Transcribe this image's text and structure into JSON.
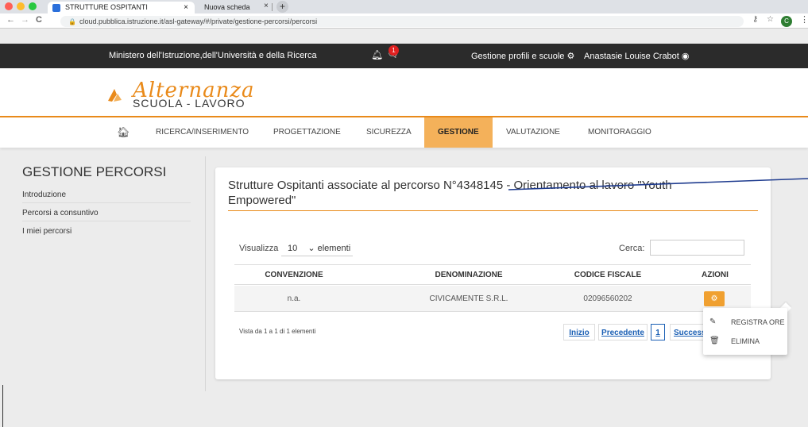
{
  "browser": {
    "active_tab": "STRUTTURE OSPITANTI",
    "inactive_tab": "Nuova scheda",
    "close_glyph": "×",
    "newtab_glyph": "+",
    "url": "cloud.pubblica.istruzione.it/asl-gateway/#/private/gestione-percorsi/percorsi",
    "profile_initial": "C",
    "traffic_colors": [
      "#ff5f57",
      "#febc2e",
      "#28c840"
    ]
  },
  "topbar": {
    "ministry": "Ministero dell'Istruzione,dell'Università e della Ricerca",
    "notification_count": "1",
    "profiles_link": "Gestione profili e scuole",
    "user_name": "Anastasie Louise Crabot"
  },
  "logo": {
    "script": "Alternanza",
    "subtitle": "SCUOLA - LAVORO",
    "accent": "#e98a1a"
  },
  "nav": {
    "items": [
      "RICERCA/INSERIMENTO",
      "PROGETTAZIONE",
      "SICUREZZA",
      "GESTIONE",
      "VALUTAZIONE",
      "MONITORAGGIO"
    ],
    "active": "GESTIONE"
  },
  "sidebar": {
    "title": "GESTIONE PERCORSI",
    "items": [
      "Introduzione",
      "Percorsi a consuntivo",
      "I miei percorsi"
    ]
  },
  "card": {
    "title": "Strutture Ospitanti associate al percorso N°4348145 - Orientamento al lavoro \"Youth Empowered\"",
    "show_label": "Visualizza",
    "show_value": "10",
    "show_suffix": "elementi",
    "search_label": "Cerca:",
    "columns": [
      "CONVENZIONE",
      "DENOMINAZIONE",
      "CODICE FISCALE",
      "AZIONI"
    ],
    "rows": [
      {
        "convenzione": "n.a.",
        "denominazione": "CIVICAMENTE S.R.L.",
        "codice_fiscale": "02096560202"
      }
    ],
    "info": "Vista da 1 a 1 di 1 elementi",
    "pager": {
      "first": "Inizio",
      "prev": "Precedente",
      "current": "1",
      "next": "Successi"
    }
  },
  "dropdown": {
    "items": [
      {
        "icon": "edit-icon",
        "label": "REGISTRA ORE"
      },
      {
        "icon": "trash-icon",
        "label": "ELIMINA"
      }
    ]
  }
}
